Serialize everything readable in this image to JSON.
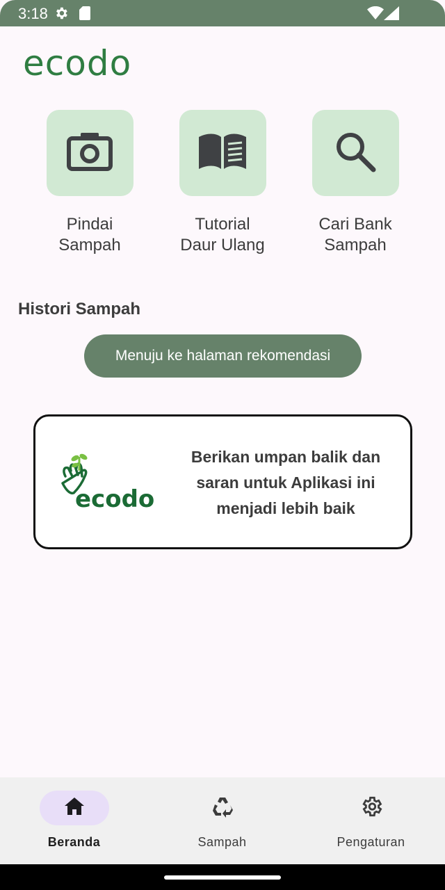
{
  "status_bar": {
    "time": "3:18"
  },
  "app": {
    "logo": "ecodo"
  },
  "features": [
    {
      "label_line1": "Pindai",
      "label_line2": "Sampah",
      "icon": "camera-icon"
    },
    {
      "label_line1": "Tutorial",
      "label_line2": "Daur Ulang",
      "icon": "book-icon"
    },
    {
      "label_line1": "Cari Bank",
      "label_line2": "Sampah",
      "icon": "search-icon"
    }
  ],
  "history": {
    "title": "Histori Sampah",
    "button_label": "Menuju ke halaman rekomendasi"
  },
  "feedback": {
    "logo_text": "ecodo",
    "text": "Berikan umpan balik dan saran untuk Aplikasi ini menjadi lebih baik"
  },
  "bottom_nav": [
    {
      "label": "Beranda",
      "icon": "home-icon",
      "active": true
    },
    {
      "label": "Sampah",
      "icon": "recycle-icon",
      "active": false
    },
    {
      "label": "Pengaturan",
      "icon": "settings-icon",
      "active": false
    }
  ],
  "colors": {
    "primary": "#66826a",
    "tile": "#d1e9d3",
    "brand_green": "#2f7d42",
    "nav_active": "#e8def8"
  }
}
